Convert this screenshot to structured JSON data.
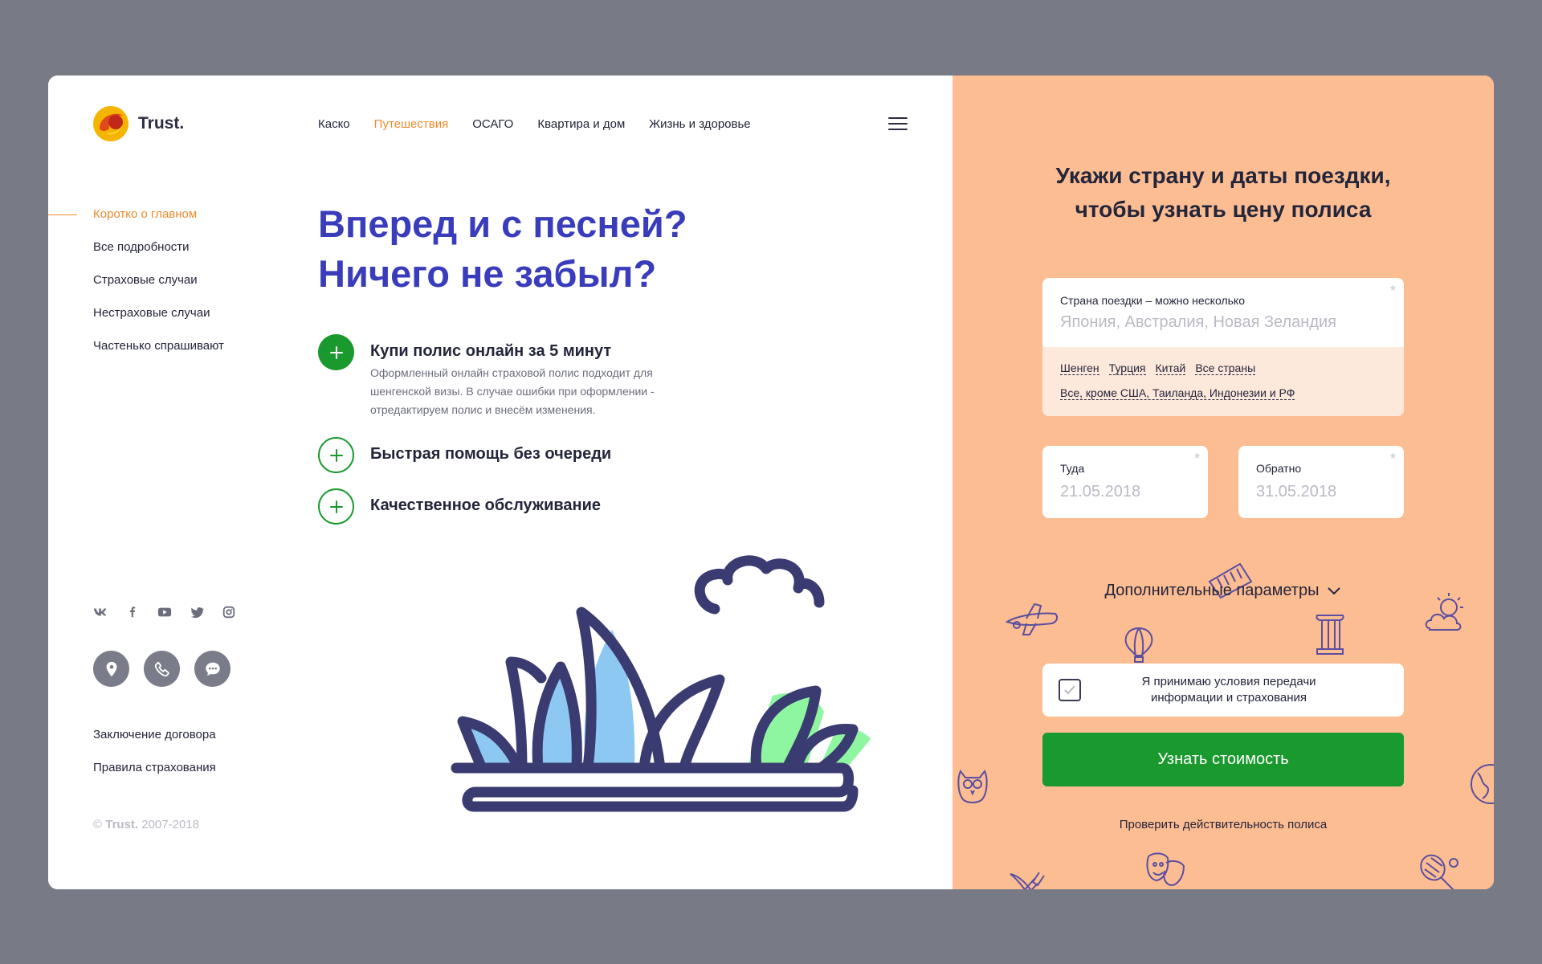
{
  "brand": {
    "name": "Trust."
  },
  "nav": {
    "items": [
      {
        "label": "Каско",
        "active": false
      },
      {
        "label": "Путешествия",
        "active": true
      },
      {
        "label": "ОСАГО",
        "active": false
      },
      {
        "label": "Квартира и дом",
        "active": false
      },
      {
        "label": "Жизнь и  здоровье",
        "active": false
      }
    ]
  },
  "side_menu": {
    "items": [
      {
        "label": "Коротко о главном",
        "active": true
      },
      {
        "label": "Все подробности"
      },
      {
        "label": "Страховые случаи"
      },
      {
        "label": "Нестраховые случаи"
      },
      {
        "label": "Частенько спрашивают"
      }
    ]
  },
  "socials": [
    "vk-icon",
    "facebook-icon",
    "youtube-icon",
    "twitter-icon",
    "instagram-icon"
  ],
  "contact_buttons": [
    "location-icon",
    "phone-icon",
    "chat-icon"
  ],
  "bottom_links": [
    "Заключение договора",
    "Правила страхования"
  ],
  "copyright": {
    "brand": "Trust.",
    "years": " 2007-2018"
  },
  "hero": {
    "line1": "Вперед и с песней?",
    "line2": "Ничего не забыл?"
  },
  "features": [
    {
      "title": "Купи полис онлайн за 5 минут",
      "description": "Оформленный онлайн страховой полис подходит для шенгенской визы. В случае ошибки при оформлении - отредактируем полис и внесём изменения."
    },
    {
      "title": "Быстрая помощь без очереди"
    },
    {
      "title": "Качественное обслуживание"
    }
  ],
  "form": {
    "title_line1": "Укажи страну и даты поездки,",
    "title_line2": "чтобы узнать цену полиса",
    "country": {
      "label": "Страна поездки – можно несколько",
      "placeholder": "Япония, Австралия, Новая Зеландия",
      "required_mark": "*",
      "chips": [
        "Шенген",
        "Турция",
        "Китай",
        "Все страны"
      ],
      "chip_long": "Все, кроме США, Таиланда, Индонезии и РФ"
    },
    "date_from": {
      "label": "Туда",
      "value": "21.05.2018",
      "required_mark": "*"
    },
    "date_to": {
      "label": "Обратно",
      "value": "31.05.2018",
      "required_mark": "*"
    },
    "extra_params": "Дополнительные параметры",
    "agree": {
      "line1": "Я принимаю условия передачи",
      "line2": "информации и страхования",
      "checked": true
    },
    "submit": "Узнать стоимость",
    "check_link": "Проверить действительность полиса"
  },
  "colors": {
    "accent_orange": "#f08a2c",
    "hero_blue": "#3a3dbb",
    "green": "#1a9a2e",
    "panel_peach": "#fdbd93"
  }
}
